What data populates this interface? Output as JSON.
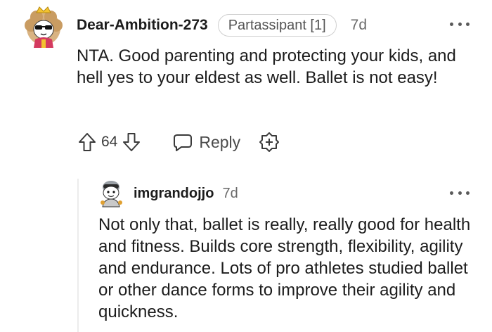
{
  "comment": {
    "username": "Dear-Ambition-273",
    "flair": "Partassipant [1]",
    "time": "7d",
    "body": "NTA. Good parenting and protecting your kids, and hell yes to your eldest as well. Ballet is not easy!",
    "votes": "64",
    "reply_label": "Reply",
    "icons": [
      "avatar",
      "more-options-icon",
      "upvote-icon",
      "downvote-icon",
      "reply-icon",
      "award-icon"
    ]
  },
  "reply": {
    "username": "imgrandojjo",
    "time": "7d",
    "body": "Not only that, ballet is really, really good for health and fitness. Builds core strength, flexibility, agility and endurance. Lots of pro athletes studied ballet or other dance forms to improve their agility and quickness.",
    "icons": [
      "avatar",
      "more-options-icon"
    ]
  },
  "colors": {
    "text": "#1c1c1c",
    "muted": "#6a6a6a",
    "thread_line": "#ececec",
    "flair_border": "#cfcfcf"
  }
}
